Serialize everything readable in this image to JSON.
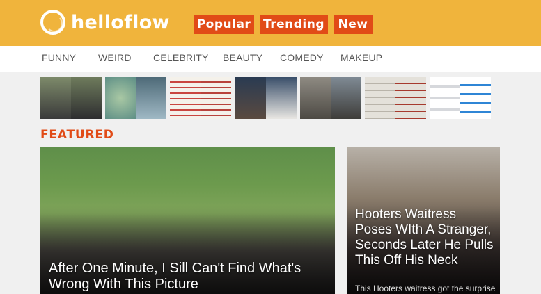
{
  "brand": {
    "name": "helloflow"
  },
  "header_buttons": [
    {
      "label": "Popular"
    },
    {
      "label": "Trending"
    },
    {
      "label": "New"
    }
  ],
  "nav": [
    {
      "label": "FUNNY"
    },
    {
      "label": "WEIRD"
    },
    {
      "label": "CELEBRITY"
    },
    {
      "label": "BEAUTY"
    },
    {
      "label": "COMEDY"
    },
    {
      "label": "MAKEUP"
    }
  ],
  "section_title": "FEATURED",
  "featured": {
    "main": {
      "title": "After One Minute, I Sill Can't Find What's Wrong With This Picture"
    },
    "side": {
      "title": "Hooters Waitress Poses WIth A Stranger, Seconds Later He Pulls This Off His Neck",
      "subtitle": "This Hooters waitress got the surprise"
    }
  },
  "colors": {
    "header_bg": "#f0b43c",
    "accent": "#e14b17",
    "nav_bg": "#ffffff",
    "page_bg": "#f0f0f0"
  }
}
